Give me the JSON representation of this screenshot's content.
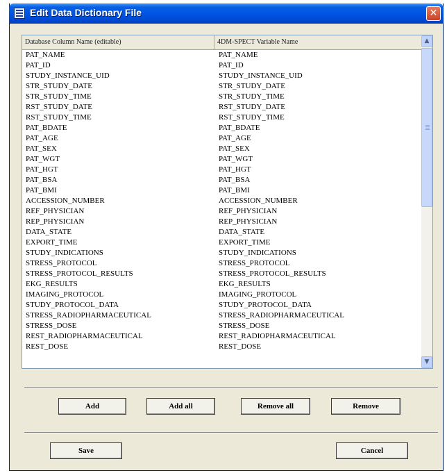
{
  "window": {
    "title": "Edit Data Dictionary File",
    "close_glyph": "✕"
  },
  "table": {
    "columns": [
      "Database Column Name (editable)",
      "4DM-SPECT Variable Name"
    ],
    "rows": [
      [
        "PAT_NAME",
        "PAT_NAME"
      ],
      [
        "PAT_ID",
        "PAT_ID"
      ],
      [
        "STUDY_INSTANCE_UID",
        "STUDY_INSTANCE_UID"
      ],
      [
        "STR_STUDY_DATE",
        "STR_STUDY_DATE"
      ],
      [
        "STR_STUDY_TIME",
        "STR_STUDY_TIME"
      ],
      [
        "RST_STUDY_DATE",
        "RST_STUDY_DATE"
      ],
      [
        "RST_STUDY_TIME",
        "RST_STUDY_TIME"
      ],
      [
        "PAT_BDATE",
        "PAT_BDATE"
      ],
      [
        "PAT_AGE",
        "PAT_AGE"
      ],
      [
        "PAT_SEX",
        "PAT_SEX"
      ],
      [
        "PAT_WGT",
        "PAT_WGT"
      ],
      [
        "PAT_HGT",
        "PAT_HGT"
      ],
      [
        "PAT_BSA",
        "PAT_BSA"
      ],
      [
        "PAT_BMI",
        "PAT_BMI"
      ],
      [
        "ACCESSION_NUMBER",
        "ACCESSION_NUMBER"
      ],
      [
        "REF_PHYSICIAN",
        "REF_PHYSICIAN"
      ],
      [
        "REP_PHYSICIAN",
        "REP_PHYSICIAN"
      ],
      [
        "DATA_STATE",
        "DATA_STATE"
      ],
      [
        "EXPORT_TIME",
        "EXPORT_TIME"
      ],
      [
        "STUDY_INDICATIONS",
        "STUDY_INDICATIONS"
      ],
      [
        "STRESS_PROTOCOL",
        "STRESS_PROTOCOL"
      ],
      [
        "STRESS_PROTOCOL_RESULTS",
        "STRESS_PROTOCOL_RESULTS"
      ],
      [
        "EKG_RESULTS",
        "EKG_RESULTS"
      ],
      [
        "IMAGING_PROTOCOL",
        "IMAGING_PROTOCOL"
      ],
      [
        "STUDY_PROTOCOL_DATA",
        "STUDY_PROTOCOL_DATA"
      ],
      [
        "STRESS_RADIOPHARMACEUTICAL",
        "STRESS_RADIOPHARMACEUTICAL"
      ],
      [
        "STRESS_DOSE",
        "STRESS_DOSE"
      ],
      [
        "REST_RADIOPHARMACEUTICAL",
        "REST_RADIOPHARMACEUTICAL"
      ],
      [
        "REST_DOSE",
        "REST_DOSE"
      ]
    ],
    "scroll_up_glyph": "▲",
    "scroll_down_glyph": "▼"
  },
  "buttons": {
    "add": "Add",
    "add_all": "Add all",
    "remove_all": "Remove all",
    "remove": "Remove",
    "save": "Save",
    "cancel": "Cancel"
  },
  "colors": {
    "titlebar": "#0055e5",
    "dialog_bg": "#ece9d8",
    "close_button": "#d8603e"
  },
  "icons": [
    "window-icon",
    "close-icon",
    "scroll-up-icon",
    "scroll-down-icon"
  ]
}
